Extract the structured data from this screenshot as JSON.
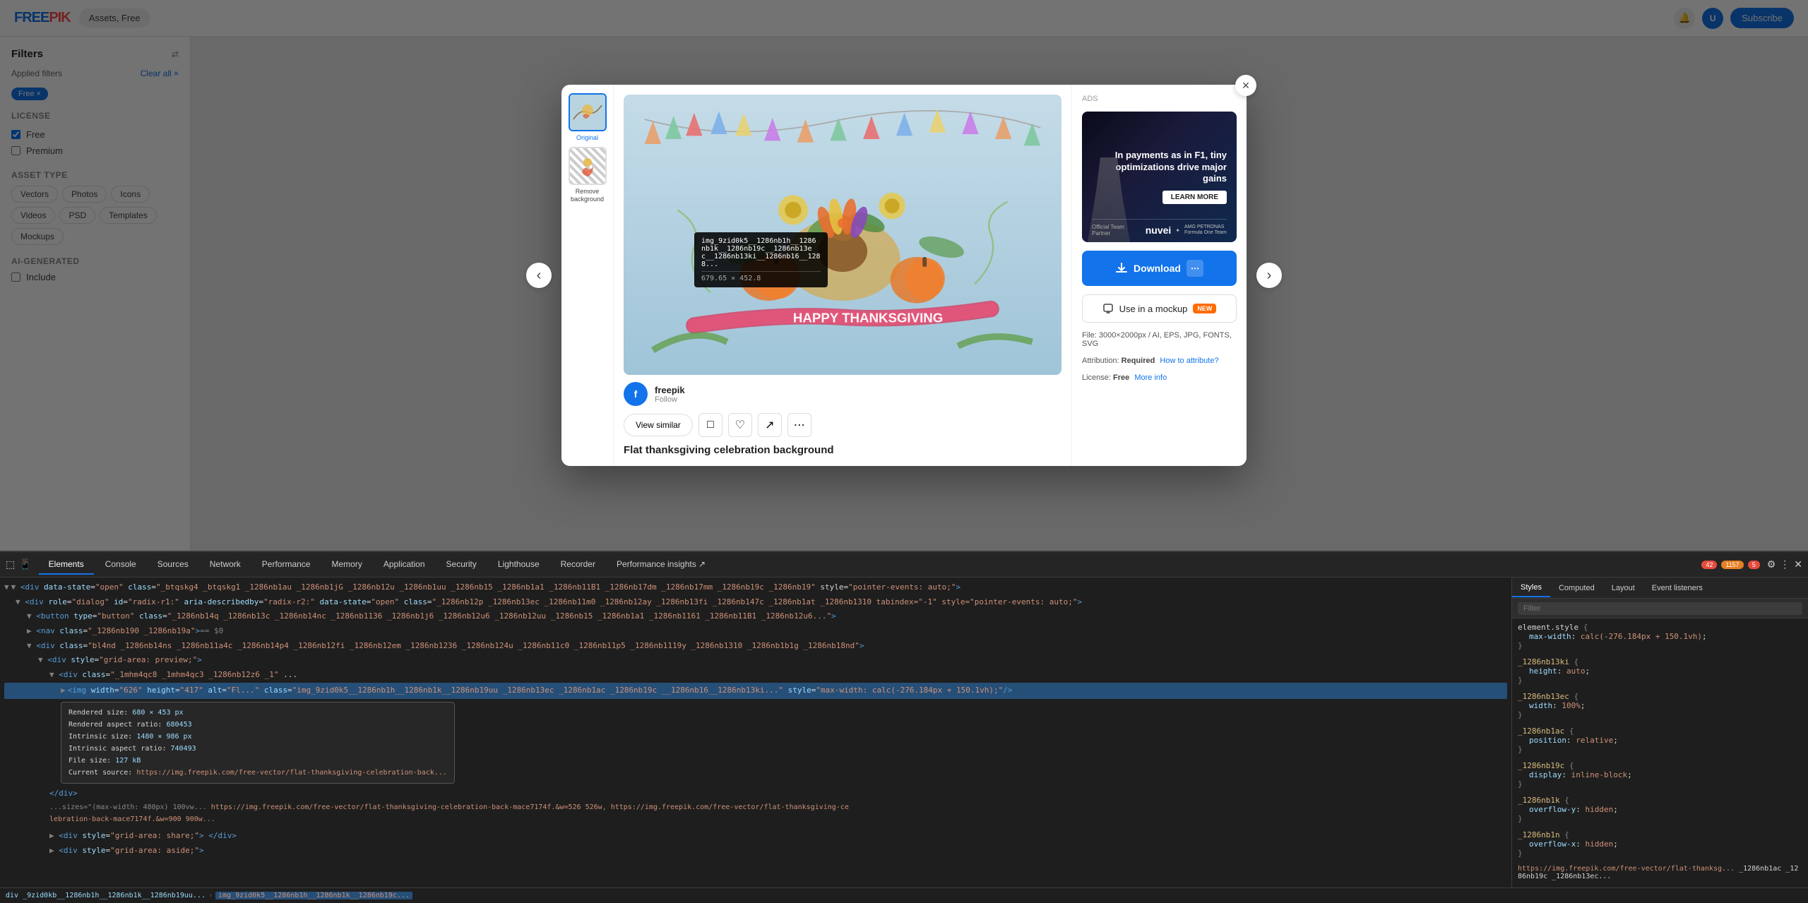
{
  "app": {
    "name": "FREEPIK",
    "logo_text": "FREEPIK",
    "nav_items": [
      "Assets, Free"
    ]
  },
  "modal": {
    "title": "Flat thanksgiving celebration background",
    "author": {
      "name": "freepik",
      "initial": "f",
      "follow_label": "Follow"
    },
    "thumbnail_original_label": "Original",
    "thumbnail_remove_bg_label": "Remove background",
    "download_btn": "Download",
    "mockup_btn": "Use in a mockup",
    "mockup_badge": "NEW",
    "view_similar_btn": "View similar",
    "file_info": "File: 3000×2000px / AI, EPS, JPG, FONTS, SVG",
    "attribution_label": "Attribution:",
    "attribution_required": "Required",
    "attribution_link": "How to attribute?",
    "license_label": "License:",
    "license_type": "Free",
    "license_link": "More info",
    "close_label": "×",
    "prev_arrow": "‹",
    "next_arrow": "›"
  },
  "ad": {
    "label": "ADS",
    "headline": "In payments as in F1, tiny optimizations drive major gains",
    "learn_btn": "LEARN MORE",
    "partner_label": "Official Team Partner",
    "brand1": "nuvei",
    "brand2": "AMG PETRONAS Formula One Team"
  },
  "devtools": {
    "tabs": [
      "Elements",
      "Console",
      "Sources",
      "Network",
      "Performance",
      "Memory",
      "Application",
      "Security",
      "Lighthouse",
      "Recorder",
      "Performance insights ↗"
    ],
    "active_tab": "Elements",
    "styles_tabs": [
      "Styles",
      "Computed",
      "Layout",
      "Event listeners"
    ],
    "active_styles_tab": "Styles",
    "filter_placeholder": "Filter",
    "icons_right": [
      "42",
      "1157",
      "5"
    ],
    "computed_label": "Computed",
    "css_rules": [
      {
        "selector": "element.style {",
        "properties": [
          {
            "prop": "max-width",
            "value": "calc(-276.184px + 150.1vh);"
          }
        ]
      },
      {
        "selector": "_1286nb13ki {",
        "properties": [
          {
            "prop": "height",
            "value": "auto;"
          }
        ]
      },
      {
        "selector": "_1286nb13ec {",
        "properties": [
          {
            "prop": "width",
            "value": "100%;"
          }
        ]
      },
      {
        "selector": "_1286nb1ac {",
        "properties": [
          {
            "prop": "position",
            "value": "relative;"
          }
        ]
      },
      {
        "selector": "_1286nb19c {",
        "properties": [
          {
            "prop": "display",
            "value": "inline-block;"
          }
        ]
      },
      {
        "selector": "_1286nb1k {",
        "properties": [
          {
            "prop": "overflow-y",
            "value": "hidden;"
          }
        ]
      },
      {
        "selector": "_1286nb1n {",
        "properties": [
          {
            "prop": "overflow-x",
            "value": "hidden;"
          }
        ]
      }
    ],
    "html_selected": "img_9zid0k5__1286nb1h__1286nb1k__1286nb19c__1286nb13ec__1286nb13ki__1286nb16__1286nb128...",
    "tooltip": {
      "class_name": "img_9zid0k5__1286nb1h__1286nb1k__1286nb19c_..._1286nb16__1286nb128...",
      "size": "679.65 × 452.8"
    },
    "rendered_size": "680 × 453 px",
    "aspect_ratio": "680453",
    "intrinsic_size": "1480 × 986 px",
    "intrinsic_aspect": "740493",
    "file_size": "127 kB",
    "current_source": "https://img.freepik.com/..."
  },
  "bottom_bar": {
    "path": "div _9zid0kb__1286nb1h__1286nb1k__1286nb19uu...",
    "selected": "img_9zid0k5__1286nb1h__1286nb1k__1286nb19c..."
  }
}
